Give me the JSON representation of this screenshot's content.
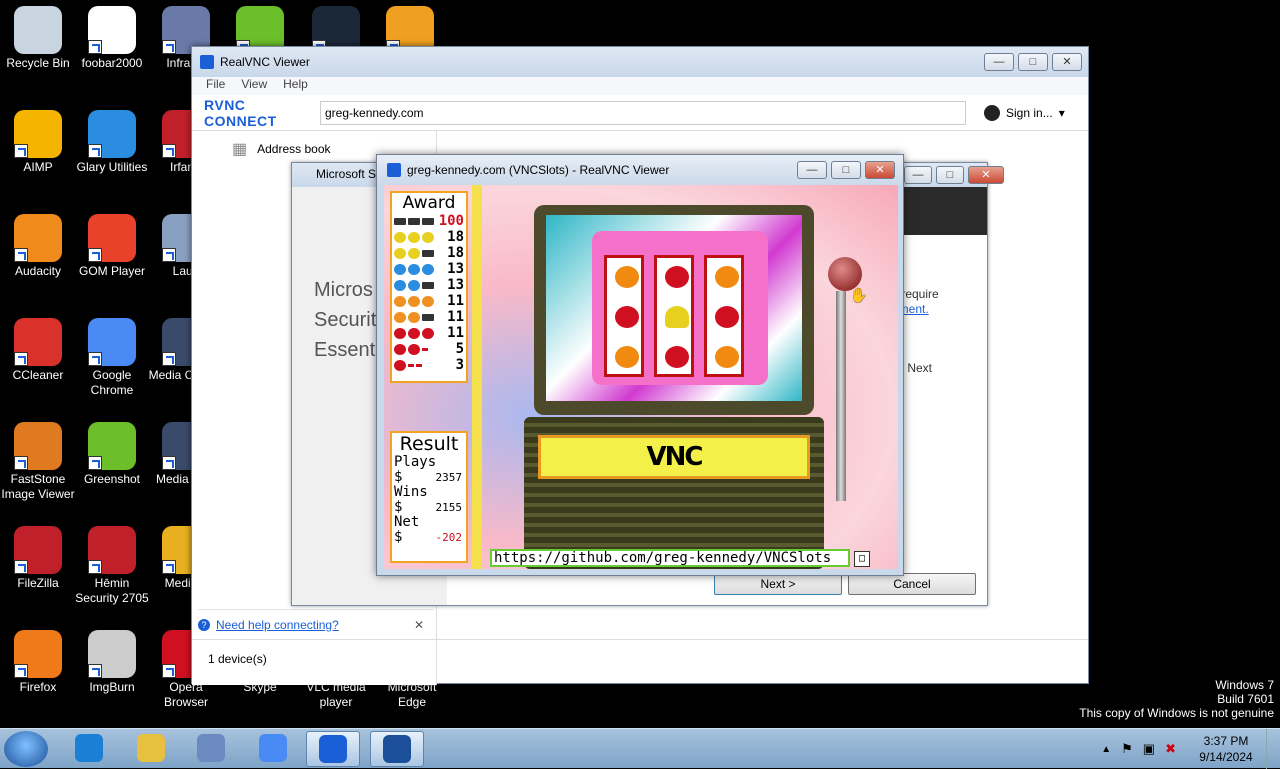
{
  "desktop": {
    "icons": [
      {
        "label": "Recycle Bin",
        "icon": "recycle-bin-icon",
        "color": "#c8d4e0"
      },
      {
        "label": "foobar2000",
        "icon": "foobar-icon",
        "color": "#ffffff"
      },
      {
        "label": "InfraRe",
        "icon": "infrarecorder-icon",
        "color": "#6a7aa8"
      },
      {
        "label": "",
        "icon": "green-app-icon",
        "color": "#6bbf2a"
      },
      {
        "label": "",
        "icon": "steam-icon",
        "color": "#1b2838"
      },
      {
        "label": "",
        "icon": "winamp-icon",
        "color": "#f0a020"
      },
      {
        "label": "AIMP",
        "icon": "aimp-icon",
        "color": "#f5b400"
      },
      {
        "label": "Glary Utilities",
        "icon": "glary-icon",
        "color": "#2a8de0"
      },
      {
        "label": "IrfanV",
        "icon": "irfanview-icon",
        "color": "#c0202a"
      },
      {
        "label": "Audacity",
        "icon": "audacity-icon",
        "color": "#f08a1a"
      },
      {
        "label": "GOM Player",
        "icon": "gom-player-icon",
        "color": "#e8432a"
      },
      {
        "label": "Laun",
        "icon": "launcher-icon",
        "color": "#8aa0c0"
      },
      {
        "label": "CCleaner",
        "icon": "ccleaner-icon",
        "color": "#d8322a"
      },
      {
        "label": "Google Chrome",
        "icon": "chrome-icon",
        "color": "#4a8af4"
      },
      {
        "label": "Media Classic",
        "icon": "media-player-classic-icon",
        "color": "#3a4a6a"
      },
      {
        "label": "FastStone Image Viewer",
        "icon": "faststone-icon",
        "color": "#e07a20"
      },
      {
        "label": "Greenshot",
        "icon": "greenshot-icon",
        "color": "#6cbf2a"
      },
      {
        "label": "Media Clas",
        "icon": "media-player-classic-icon",
        "color": "#3a4a6a"
      },
      {
        "label": "FileZilla",
        "icon": "filezilla-icon",
        "color": "#c0202a"
      },
      {
        "label": "Hēmin Security 2705",
        "icon": "hemin-security-icon",
        "color": "#c0202a"
      },
      {
        "label": "MediaM",
        "icon": "mediamonkey-icon",
        "color": "#e8b020"
      },
      {
        "label": "Firefox",
        "icon": "firefox-icon",
        "color": "#f07a1a"
      },
      {
        "label": "ImgBurn",
        "icon": "imgburn-icon",
        "color": "#cccccc"
      },
      {
        "label": "Opera Browser",
        "icon": "opera-icon",
        "color": "#d01020"
      },
      {
        "label": "Skype",
        "icon": "skype-icon",
        "color": "#00aff0"
      },
      {
        "label": "VLC media player",
        "icon": "vlc-icon",
        "color": "#f08a1a"
      },
      {
        "label": "Microsoft Edge",
        "icon": "edge-icon",
        "color": "#2a8de0"
      }
    ]
  },
  "vnc_main": {
    "title": "RealVNC Viewer",
    "menu": [
      "File",
      "View",
      "Help"
    ],
    "brand": "RVNC CONNECT",
    "address_value": "greg-kennedy.com",
    "sign_in": "Sign in...",
    "address_book": "Address book",
    "help_link": "Need help connecting?",
    "device_count": "1 device(s)"
  },
  "mse": {
    "title": "Microsoft S",
    "heading": [
      "Micros",
      "Securit",
      "Essenti"
    ],
    "note_line1": "y require",
    "note_link": "ement.",
    "click_next": "ck Next",
    "next_button": "Next >",
    "cancel_button": "Cancel"
  },
  "slots_window": {
    "title": "greg-kennedy.com (VNCSlots) - RealVNC Viewer",
    "award": {
      "title": "Award",
      "rows": [
        {
          "symbols": [
            "bar",
            "bar",
            "bar"
          ],
          "colors": [
            "#333333",
            "#333333",
            "#333333"
          ],
          "value": "100"
        },
        {
          "symbols": [
            "bell",
            "bell",
            "bell"
          ],
          "colors": [
            "#e8d020",
            "#e8d020",
            "#e8d020"
          ],
          "value": "18"
        },
        {
          "symbols": [
            "bell",
            "bell",
            "bar"
          ],
          "colors": [
            "#e8d020",
            "#e8d020",
            "#333333"
          ],
          "value": "18"
        },
        {
          "symbols": [
            "plum",
            "plum",
            "plum"
          ],
          "colors": [
            "#2a8de0",
            "#2a8de0",
            "#2a8de0"
          ],
          "value": "13"
        },
        {
          "symbols": [
            "plum",
            "plum",
            "bar"
          ],
          "colors": [
            "#2a8de0",
            "#2a8de0",
            "#333333"
          ],
          "value": "13"
        },
        {
          "symbols": [
            "orange",
            "orange",
            "orange"
          ],
          "colors": [
            "#f09020",
            "#f09020",
            "#f09020"
          ],
          "value": "11"
        },
        {
          "symbols": [
            "orange",
            "orange",
            "bar"
          ],
          "colors": [
            "#f09020",
            "#f09020",
            "#333333"
          ],
          "value": "11"
        },
        {
          "symbols": [
            "cherry",
            "cherry",
            "cherry"
          ],
          "colors": [
            "#d01020",
            "#d01020",
            "#d01020"
          ],
          "value": "11"
        },
        {
          "symbols": [
            "cherry",
            "cherry",
            "any"
          ],
          "colors": [
            "#d01020",
            "#d01020",
            "#d01020"
          ],
          "value": "5"
        },
        {
          "symbols": [
            "cherry",
            "any",
            "any"
          ],
          "colors": [
            "#d01020",
            "#d01020",
            "#d01020"
          ],
          "value": "3"
        }
      ]
    },
    "result": {
      "title": "Result",
      "plays_label": "Plays",
      "plays_value": "2357",
      "wins_label": "Wins",
      "wins_value": "2155",
      "net_label": "Net",
      "net_value": "-202",
      "currency": "$"
    },
    "reels": [
      [
        "orange",
        "cherry",
        "orange"
      ],
      [
        "cherry",
        "bell",
        "cherry"
      ],
      [
        "orange",
        "cherry",
        "orange"
      ]
    ],
    "reel_colors": {
      "orange": "#f08a10",
      "cherry": "#d01020",
      "bell": "#e8d020"
    },
    "logo": "VNC",
    "url": "https://github.com/greg-kennedy/VNCSlots"
  },
  "watermark": {
    "line1": "Windows 7",
    "line2": "Build 7601",
    "line3": "This copy of Windows is not genuine"
  },
  "taskbar": {
    "time": "3:37 PM",
    "date": "9/14/2024",
    "apps": [
      "ie-icon",
      "explorer-icon",
      "media-player-icon",
      "chrome-icon",
      "realvnc-icon",
      "mse-icon"
    ]
  }
}
